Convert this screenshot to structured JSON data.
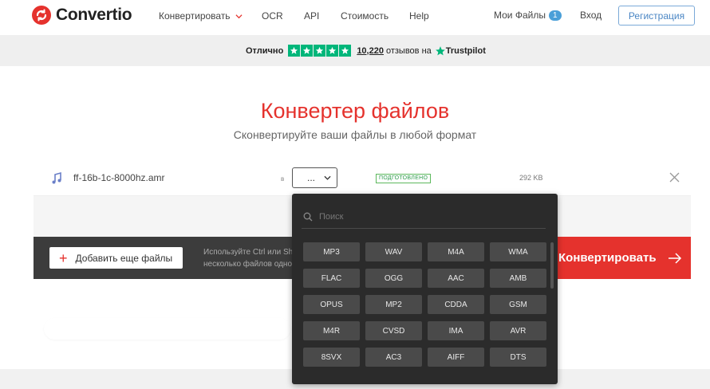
{
  "header": {
    "brand": "Convertio",
    "nav": [
      {
        "label": "Конвертировать"
      },
      {
        "label": "OCR"
      },
      {
        "label": "API"
      },
      {
        "label": "Стоимость"
      },
      {
        "label": "Help"
      }
    ],
    "my_files_label": "Мои Файлы",
    "my_files_count": "1",
    "login_label": "Вход",
    "signup_label": "Регистрация"
  },
  "trustpilot": {
    "rating_label": "Отлично",
    "review_count": "10,220",
    "review_text": "отзывов на",
    "brand": "Trustpilot"
  },
  "hero": {
    "title": "Конвертер файлов",
    "subtitle": "Сконвертируйте ваши файлы в любой формат"
  },
  "file": {
    "name": "ff-16b-1c-8000hz.amr",
    "to_label": "в",
    "selected_format": "...",
    "status": "ПОДГОТОВЛЕНО",
    "size": "292 KB"
  },
  "actions": {
    "add_label": "Добавить еще файлы",
    "hint_line1": "Используйте Ctrl или Sh",
    "hint_line2": "несколько файлов одно",
    "convert_label": "Конвертировать"
  },
  "dropdown": {
    "search_placeholder": "Поиск",
    "formats": [
      "MP3",
      "WAV",
      "M4A",
      "WMA",
      "FLAC",
      "OGG",
      "AAC",
      "AMB",
      "OPUS",
      "MP2",
      "CDDA",
      "GSM",
      "M4R",
      "CVSD",
      "IMA",
      "AVR",
      "8SVX",
      "AC3",
      "AIFF",
      "DTS"
    ]
  },
  "colors": {
    "accent": "#e5322d",
    "trustpilot_green": "#00b67a",
    "dropdown_bg": "#2b2b2b",
    "format_chip": "#4a4a4a"
  }
}
